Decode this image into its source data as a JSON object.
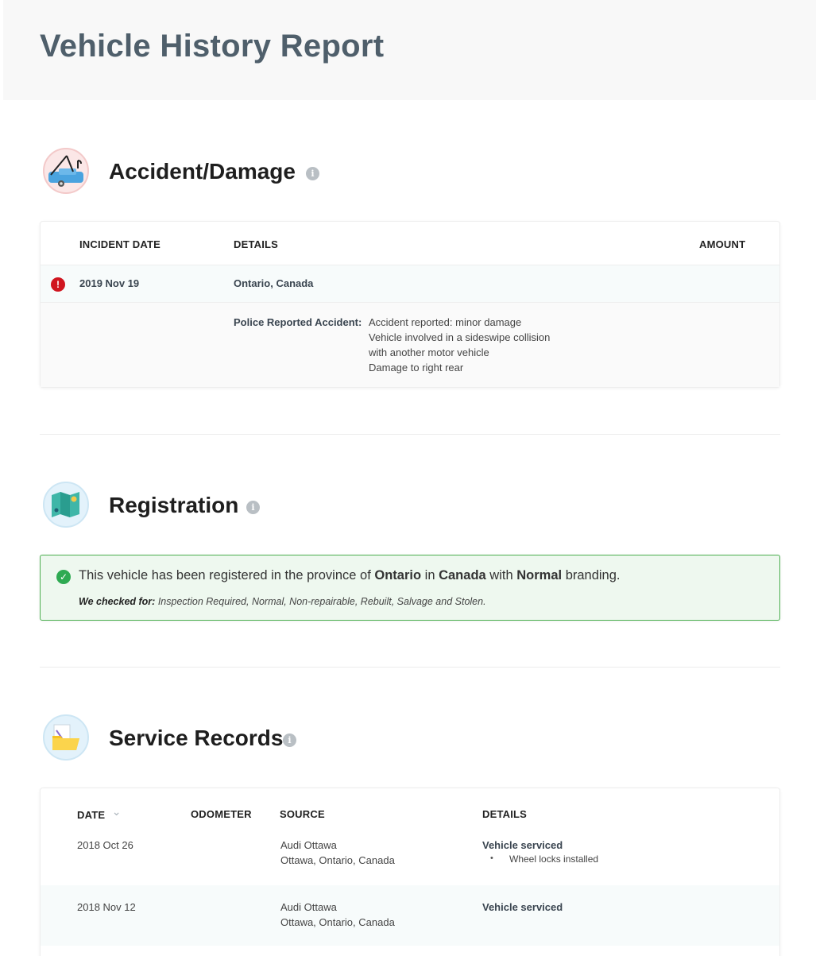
{
  "report": {
    "title": "Vehicle History Report"
  },
  "accident": {
    "title": "Accident/Damage",
    "info_glyph": "i",
    "icon": "tow-truck-icon",
    "columns": [
      "INCIDENT DATE",
      "DETAILS",
      "AMOUNT"
    ],
    "records": [
      {
        "status_icon": "alert-icon",
        "status_glyph": "!",
        "date": "2019 Nov 19",
        "location": "Ontario, Canada",
        "amount": "",
        "detail_label": "Police Reported Accident:",
        "detail_lines": [
          "Accident reported: minor damage",
          "Vehicle involved in a sideswipe collision",
          "with another motor vehicle",
          "Damage to right rear"
        ]
      }
    ],
    "colors": {
      "alert": "#d0151f",
      "row_highlight": "#f7fbfb"
    }
  },
  "registration": {
    "title": "Registration",
    "info_glyph": "i",
    "icon": "map-icon",
    "status_icon": "check-circle-icon",
    "status_glyph": "✓",
    "message": {
      "prefix": "This vehicle has been registered in the province of",
      "province": "Ontario",
      "in": "in",
      "country": "Canada",
      "with": "with",
      "branding": "Normal",
      "suffix": "branding."
    },
    "checked_label": "We checked for:",
    "checked_list": "Inspection Required, Normal, Non-repairable, Rebuilt, Salvage and Stolen.",
    "colors": {
      "border": "#4caf50",
      "background": "#eef8ef",
      "check": "#2eaa52"
    }
  },
  "service": {
    "title": "Service Records",
    "info_glyph": "i",
    "icon": "folder-icon",
    "sort_glyph": "⌄",
    "columns": [
      "DATE",
      "ODOMETER",
      "SOURCE",
      "DETAILS"
    ],
    "records": [
      {
        "date": "2018 Oct 26",
        "odometer": "",
        "source_name": "Audi Ottawa",
        "source_location": "Ottawa, Ontario, Canada",
        "detail_title": "Vehicle serviced",
        "detail_items": [
          "Wheel locks installed"
        ]
      },
      {
        "date": "2018 Nov 12",
        "odometer": "",
        "source_name": "Audi Ottawa",
        "source_location": "Ottawa, Ontario, Canada",
        "detail_title": "Vehicle serviced",
        "detail_items": []
      }
    ],
    "colors": {
      "row_alt": "#f7fbfb"
    }
  }
}
